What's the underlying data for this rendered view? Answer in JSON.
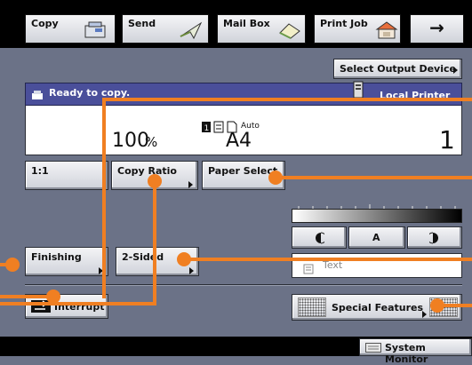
{
  "tabs": [
    {
      "label": "Copy",
      "icon": "copier-icon"
    },
    {
      "label": "Send",
      "icon": "send-icon"
    },
    {
      "label": "Mail Box",
      "icon": "mailbox-icon"
    },
    {
      "label": "Print Job",
      "icon": "print-job-icon"
    }
  ],
  "arrow_button": "→",
  "select_output_device": "Select Output Device",
  "status": {
    "message": "Ready to copy.",
    "printer": "Local Printer"
  },
  "display": {
    "ratio": "100",
    "ratio_unit": "%",
    "paper_size": "A4",
    "paper_mode": "Auto",
    "copies": "1"
  },
  "buttons": {
    "one_to_one": "1:1",
    "copy_ratio": "Copy Ratio",
    "paper_select": "Paper Select",
    "finishing": "Finishing",
    "two_sided": "2-Sided",
    "interrupt": "Interrupt",
    "special_features": "Special Features",
    "system_monitor": "System Monitor"
  },
  "density": {
    "auto_label": "A"
  },
  "original_type": {
    "value": "Text"
  },
  "colors": {
    "accent": "#f07f22",
    "status_bar": "#4a4f9a",
    "background": "#6b7287"
  }
}
